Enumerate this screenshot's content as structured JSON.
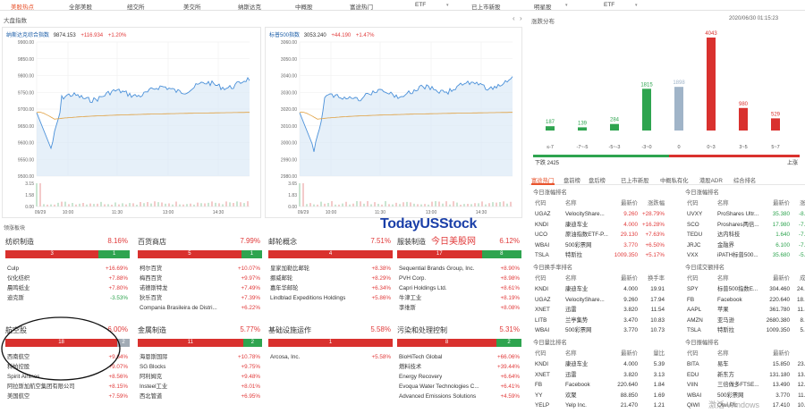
{
  "nav": {
    "items": [
      {
        "label": "美股热点",
        "active": true
      },
      {
        "label": "全部美股",
        "active": false
      },
      {
        "label": "纽交所",
        "active": false
      },
      {
        "label": "美交所",
        "active": false
      },
      {
        "label": "纳斯达克",
        "active": false
      },
      {
        "label": "中概股",
        "active": false
      },
      {
        "label": "富途热门",
        "active": false
      },
      {
        "label": "ETF",
        "active": false,
        "dropdown": true
      },
      {
        "label": "已上市新股",
        "active": false
      },
      {
        "label": "明星股",
        "active": false,
        "dropdown": true
      },
      {
        "label": "ETF",
        "active": false,
        "dropdown": true
      }
    ]
  },
  "index_section": {
    "title": "大盘指数"
  },
  "nasdaq": {
    "name": "纳斯达克综合指数",
    "price": "9874.153",
    "change": "+116.934",
    "pct": "+1.20%"
  },
  "sp500": {
    "name": "标普500指数",
    "price": "3053.240",
    "change": "+44.190",
    "pct": "+1.47%"
  },
  "nasdaq_axis": {
    "y": [
      "9900.00",
      "9850.00",
      "9800.00",
      "9750.00",
      "9700.00",
      "9650.00",
      "9600.00",
      "9550.00",
      "9500.00"
    ],
    "x": [
      "09/29",
      "10:00",
      "11:30",
      "13:00",
      "14:30"
    ],
    "vol": [
      "3.15",
      "1.58",
      "0.00"
    ]
  },
  "sp500_axis": {
    "y": [
      "3060.00",
      "3050.00",
      "3040.00",
      "3030.00",
      "3020.00",
      "3010.00",
      "3000.00",
      "2990.00",
      "2980.00"
    ],
    "x": [
      "09/29",
      "10:00",
      "11:30",
      "13:00",
      "14:30"
    ],
    "vol": [
      "3.65",
      "1.83",
      "0.00"
    ]
  },
  "dist": {
    "title": "涨跌分布",
    "timestamp": "2020/06/30 01:15:23",
    "chart_data": {
      "type": "bar",
      "categories": [
        "≤-7",
        "-7~-5",
        "-5~-3",
        "-3~0",
        "0",
        "0~3",
        "3~5",
        "5~7"
      ],
      "values": [
        187,
        139,
        284,
        1815,
        1898,
        4043,
        980,
        529
      ],
      "colors": [
        "#2ea44f",
        "#2ea44f",
        "#2ea44f",
        "#2ea44f",
        "#a0b4c8",
        "#d9312e",
        "#d9312e",
        "#d9312e"
      ]
    },
    "down_label": "下跌 2425",
    "up_label": "上涨"
  },
  "logo": {
    "text": "TodayUSStock",
    "sub": "今日美股网"
  },
  "sector": {
    "title": "领涨板块",
    "cards": [
      {
        "name": "纺织制造",
        "pct": "8.16%",
        "up": "3",
        "flat": "",
        "down": "1",
        "rows": [
          [
            "Culp",
            "+16.69%"
          ],
          [
            "仪化纺织",
            "+7.88%"
          ],
          [
            "晨鸣纸业",
            "+7.80%"
          ],
          [
            "迪克斯",
            "-3.53%"
          ]
        ]
      },
      {
        "name": "百货商店",
        "pct": "7.99%",
        "up": "5",
        "flat": "",
        "down": "1",
        "rows": [
          [
            "柯尔百货",
            "+10.07%"
          ],
          [
            "梅西百货",
            "+9.97%"
          ],
          [
            "诺德斯特龙",
            "+7.49%"
          ],
          [
            "狄乐百货",
            "+7.39%"
          ],
          [
            "Compania Brasileira de Distri...",
            "+6.22%"
          ]
        ]
      },
      {
        "name": "邮轮概念",
        "pct": "7.51%",
        "up": "4",
        "flat": "",
        "down": "",
        "rows": [
          [
            "皇家加勒比邮轮",
            "+8.38%"
          ],
          [
            "挪威邮轮",
            "+8.29%"
          ],
          [
            "嘉年华邮轮",
            "+6.34%"
          ],
          [
            "Lindblad Expeditions Holdings",
            "+5.86%"
          ]
        ]
      },
      {
        "name": "服装制造",
        "pct": "6.12%",
        "up": "17",
        "flat": "",
        "down": "8",
        "rows": [
          [
            "Sequential Brands Group, Inc.",
            "+8.90%"
          ],
          [
            "PVH Corp.",
            "+8.98%"
          ],
          [
            "Capri Holdings Ltd.",
            "+8.61%"
          ],
          [
            "牛津工业",
            "+8.19%"
          ],
          [
            "李维斯",
            "+8.08%"
          ]
        ]
      },
      {
        "name": "航空股",
        "pct": "6.00%",
        "up": "18",
        "flat": "2",
        "down": "",
        "rows": [
          [
            "西南航空",
            "+9.64%"
          ],
          [
            "科帕控股",
            "+9.07%"
          ],
          [
            "Spirit Airlines",
            "+8.56%"
          ],
          [
            "阿拉斯加航空集团有限公司",
            "+8.15%"
          ],
          [
            "美国航空",
            "+7.59%"
          ]
        ]
      },
      {
        "name": "金属制造",
        "pct": "5.77%",
        "up": "11",
        "flat": "",
        "down": "2",
        "rows": [
          [
            "海恩斯国际",
            "+10.78%"
          ],
          [
            "SG Blocks",
            "+9.75%"
          ],
          [
            "阿利姆克",
            "+9.48%"
          ],
          [
            "Insteel工业",
            "+8.01%"
          ],
          [
            "西北管道",
            "+6.95%"
          ]
        ]
      },
      {
        "name": "基础设施运作",
        "pct": "5.58%",
        "up": "1",
        "flat": "",
        "down": "",
        "rows": [
          [
            "Arcosa, Inc.",
            "+5.58%"
          ]
        ]
      },
      {
        "name": "污染和处理控制",
        "pct": "5.31%",
        "up": "8",
        "flat": "",
        "down": "2",
        "rows": [
          [
            "BioHiTech Global",
            "+66.06%"
          ],
          [
            "燃料技术",
            "+39.44%"
          ],
          [
            "Energy Recovery",
            "+6.64%"
          ],
          [
            "Evoqua Water Technologies C...",
            "+6.41%"
          ],
          [
            "Advanced Emissions Solutions",
            "+4.59%"
          ]
        ]
      }
    ]
  },
  "rank_tabs": [
    "富途热门",
    "盘前榜",
    "盘后榜",
    "已上市新股",
    "中概私有化",
    "港股ADR",
    "综合排名"
  ],
  "tables": [
    {
      "title": "今日涨幅排名",
      "cols": [
        "代码",
        "名称",
        "最新价",
        "涨跌幅"
      ],
      "rows": [
        [
          "UGAZ",
          "VelocityShare...",
          "9.260",
          "+28.79%"
        ],
        [
          "KNDI",
          "康迪车业",
          "4.000",
          "+16.28%"
        ],
        [
          "UCO",
          "原油指数ETF-P...",
          "29.130",
          "+7.63%"
        ],
        [
          "WBAI",
          "500彩票网",
          "3.770",
          "+6.50%"
        ],
        [
          "TSLA",
          "特斯拉",
          "1009.350",
          "+5.17%"
        ]
      ]
    },
    {
      "title": "今日涨幅排名",
      "cols": [
        "代码",
        "名称",
        "最新价",
        "涨跌幅"
      ],
      "rows": [
        [
          "UVXY",
          "ProShares Ultr...",
          "35.380",
          "-8.44%"
        ],
        [
          "SCO",
          "Proshares两倍...",
          "17.980",
          "-7.67%"
        ],
        [
          "TEDU",
          "达内科技",
          "1.640",
          "-7.34%"
        ],
        [
          "JRJC",
          "金融界",
          "6.100",
          "-7.13%"
        ],
        [
          "VXX",
          "iPATH标普500...",
          "35.680",
          "-5.96%"
        ]
      ]
    },
    {
      "title": "今日换手率排名",
      "cols": [
        "代码",
        "名称",
        "最新价",
        "换手率"
      ],
      "rows": [
        [
          "KNDI",
          "康迪车业",
          "4.000",
          "19.91"
        ],
        [
          "UGAZ",
          "VelocityShare...",
          "9.260",
          "17.94"
        ],
        [
          "XNET",
          "迅雷",
          "3.820",
          "11.54"
        ],
        [
          "LITB",
          "兰亭集势",
          "3.470",
          "10.83"
        ],
        [
          "WBAI",
          "500彩票网",
          "3.770",
          "10.73"
        ]
      ]
    },
    {
      "title": "今日成交额排名",
      "cols": [
        "代码",
        "名称",
        "最新价",
        "成交额"
      ],
      "rows": [
        [
          "SPY",
          "标普500指数E...",
          "304.460",
          "24.09亿"
        ],
        [
          "FB",
          "Facebook",
          "220.640",
          "18.18亿"
        ],
        [
          "AAPL",
          "苹果",
          "361.780",
          "11.45亿"
        ],
        [
          "AMZN",
          "亚马逊",
          "2680.380",
          "8.81亿"
        ],
        [
          "TSLA",
          "特斯拉",
          "1009.350",
          "5.43亿"
        ]
      ]
    },
    {
      "title": "今日量比排名",
      "cols": [
        "代码",
        "名称",
        "最新价",
        "量比"
      ],
      "rows": [
        [
          "KNDI",
          "康迪车业",
          "4.000",
          "5.39"
        ],
        [
          "XNET",
          "迅雷",
          "3.820",
          "3.13"
        ],
        [
          "FB",
          "Facebook",
          "220.640",
          "1.84"
        ],
        [
          "YY",
          "欢聚",
          "88.850",
          "1.69"
        ],
        [
          "YELP",
          "Yelp Inc.",
          "21.470",
          "1.21"
        ]
      ]
    },
    {
      "title": "今日振幅排名",
      "cols": [
        "代码",
        "名称",
        "最新价",
        "振幅"
      ],
      "rows": [
        [
          "BITA",
          "易车",
          "15.850",
          "23.18%"
        ],
        [
          "EDU",
          "新东方",
          "131.180",
          "13.04%"
        ],
        [
          "VIIN",
          "三倍做多FTSE...",
          "13.490",
          "12.98%"
        ],
        [
          "WBAI",
          "500彩票网",
          "3.770",
          "11.72%"
        ],
        [
          "QIWI",
          "Qiwi Plc",
          "17.410",
          "10.35%"
        ]
      ]
    }
  ],
  "watermark": "激活 Windows"
}
